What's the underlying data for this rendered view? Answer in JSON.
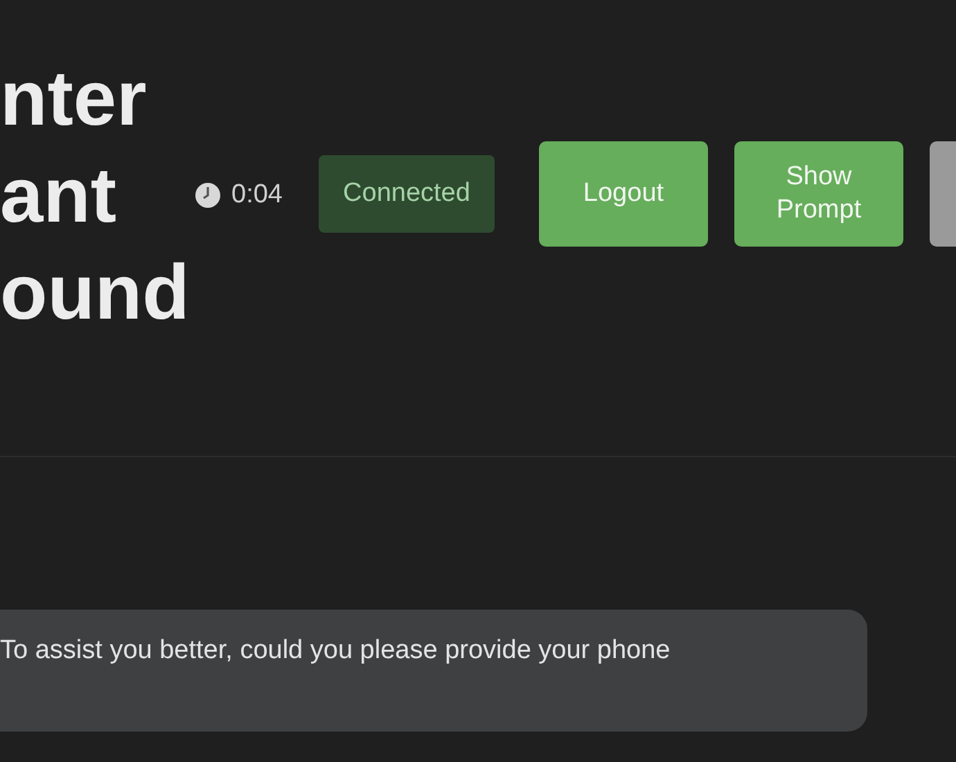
{
  "header": {
    "title_lines": [
      "nter",
      "ant",
      "ound"
    ],
    "timer": "0:04",
    "status": {
      "label": "Connected",
      "kind": "connected"
    },
    "buttons": [
      {
        "label": "Logout",
        "kind": "primary"
      },
      {
        "label": "Show Prompt",
        "kind": "primary"
      },
      {
        "kind": "secondary"
      }
    ]
  },
  "messages": [
    {
      "text": "To assist you better, could you please provide your phone",
      "kind": "assistant"
    }
  ]
}
